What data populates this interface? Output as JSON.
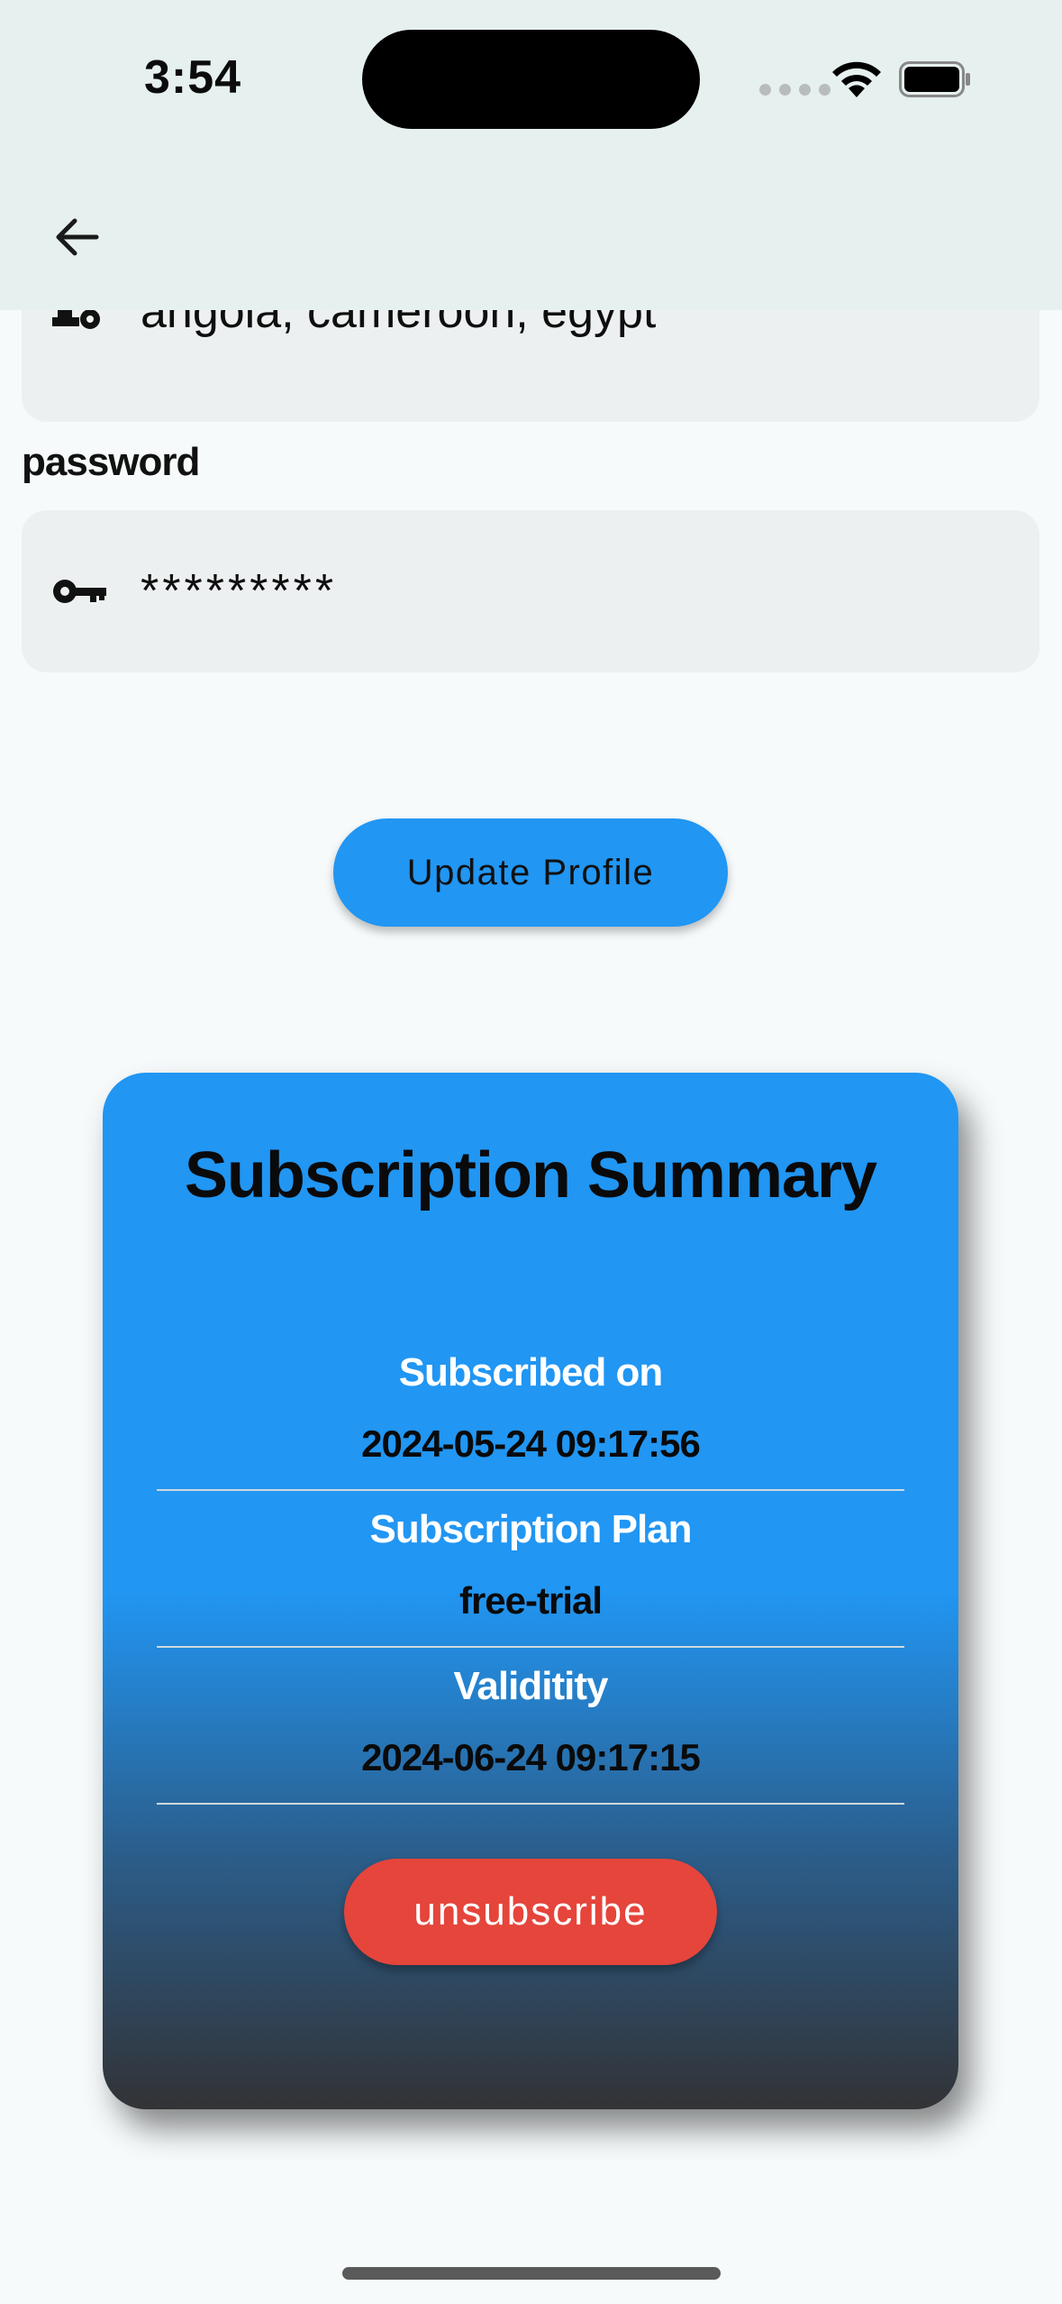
{
  "status_bar": {
    "time": "3:54"
  },
  "profile_form": {
    "countries_value": "angola, cameroon, egypt",
    "password_label": "password",
    "password_value": "*********",
    "update_button": "Update Profile"
  },
  "subscription": {
    "title": "Subscription Summary",
    "subscribed_on_label": "Subscribed on",
    "subscribed_on_value": "2024-05-24 09:17:56",
    "plan_label": "Subscription Plan",
    "plan_value": "free-trial",
    "validity_label": "Validitity",
    "validity_value": "2024-06-24 09:17:15",
    "unsubscribe_button": "unsubscribe"
  },
  "icons": [
    "back-arrow-icon",
    "location-settings-icon",
    "key-icon",
    "wifi-icon",
    "battery-icon"
  ]
}
